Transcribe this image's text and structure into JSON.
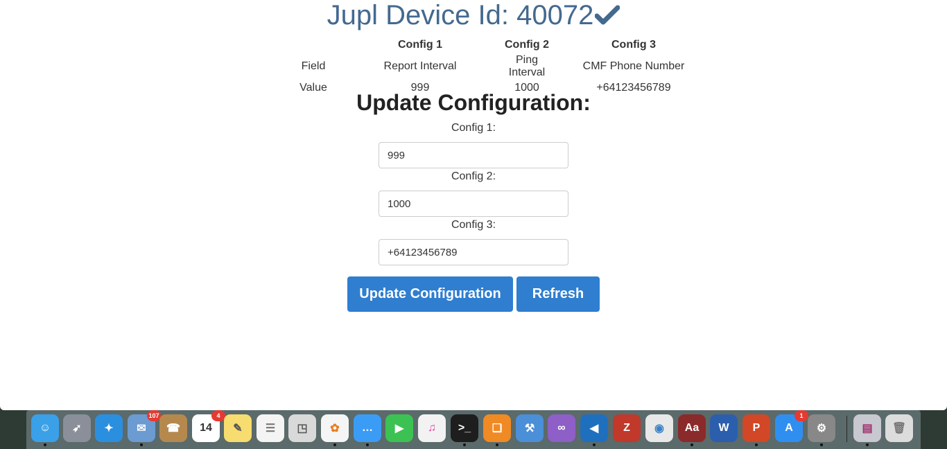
{
  "device": {
    "title_prefix": "Jupl Device Id: ",
    "device_id": "40072"
  },
  "config_table": {
    "headers": [
      "",
      "Config 1",
      "Config 2",
      "Config 3"
    ],
    "rows": [
      [
        "Field",
        "Report Interval",
        "Ping Interval",
        "CMF Phone Number"
      ],
      [
        "Value",
        "999",
        "1000",
        "+64123456789"
      ]
    ]
  },
  "update_form": {
    "heading": "Update Configuration:",
    "fields": [
      {
        "label": "Config 1:",
        "value": "999"
      },
      {
        "label": "Config 2:",
        "value": "1000"
      },
      {
        "label": "Config 3:",
        "value": "+64123456789"
      }
    ],
    "update_button": "Update Configuration",
    "refresh_button": "Refresh"
  },
  "dock": {
    "items": [
      {
        "name": "finder-icon",
        "color": "#3aa0e8",
        "glyph": "☺"
      },
      {
        "name": "launchpad-icon",
        "color": "#8a8f99",
        "glyph": "➶"
      },
      {
        "name": "safari-icon",
        "color": "#2b8fe0",
        "glyph": "✦"
      },
      {
        "name": "mail-icon",
        "color": "#6b9bd1",
        "glyph": "✉",
        "badge": "107"
      },
      {
        "name": "contacts-icon",
        "color": "#b5894e",
        "glyph": "☎"
      },
      {
        "name": "calendar-icon",
        "color": "#ffffff",
        "glyph": "14",
        "badge": "4",
        "text_color": "#333"
      },
      {
        "name": "notes-icon",
        "color": "#f7dc6f",
        "glyph": "✎",
        "text_color": "#555"
      },
      {
        "name": "reminders-icon",
        "color": "#f4f4f4",
        "glyph": "☰",
        "text_color": "#777"
      },
      {
        "name": "preview-icon",
        "color": "#d9d9d9",
        "glyph": "◳",
        "text_color": "#555"
      },
      {
        "name": "photos-icon",
        "color": "#f5f5f5",
        "glyph": "✿",
        "text_color": "#e67e22"
      },
      {
        "name": "messages-icon",
        "color": "#3b9cf5",
        "glyph": "…"
      },
      {
        "name": "facetime-icon",
        "color": "#3cc252",
        "glyph": "▶"
      },
      {
        "name": "itunes-icon",
        "color": "#f2f2f2",
        "glyph": "♫",
        "text_color": "#e0459a"
      },
      {
        "name": "terminal-icon",
        "color": "#1e1e1e",
        "glyph": ">_"
      },
      {
        "name": "ibooks-icon",
        "color": "#f08a24",
        "glyph": "❏"
      },
      {
        "name": "xcode-icon",
        "color": "#4a8fd8",
        "glyph": "⚒"
      },
      {
        "name": "visual-studio-icon",
        "color": "#8e5fc7",
        "glyph": "∞"
      },
      {
        "name": "vscode-icon",
        "color": "#1f6fbf",
        "glyph": "◀"
      },
      {
        "name": "filezilla-icon",
        "color": "#c0392b",
        "glyph": "Z"
      },
      {
        "name": "chrome-icon",
        "color": "#e8e8e8",
        "glyph": "◉",
        "text_color": "#3b82c4"
      },
      {
        "name": "dictionary-icon",
        "color": "#8b2a2a",
        "glyph": "Aa"
      },
      {
        "name": "word-icon",
        "color": "#2b5fad",
        "glyph": "W"
      },
      {
        "name": "powerpoint-icon",
        "color": "#d24726",
        "glyph": "P"
      },
      {
        "name": "app-store-icon",
        "color": "#2f8ff0",
        "glyph": "A",
        "badge": "1"
      },
      {
        "name": "system-preferences-icon",
        "color": "#888",
        "glyph": "⚙"
      },
      {
        "name": "document-stack-icon",
        "color": "#c8c8d0",
        "glyph": "▤",
        "text_color": "#a0306e"
      },
      {
        "name": "trash-icon",
        "color": "#dcdcdc",
        "glyph": "🗑",
        "text_color": "#777"
      }
    ]
  }
}
